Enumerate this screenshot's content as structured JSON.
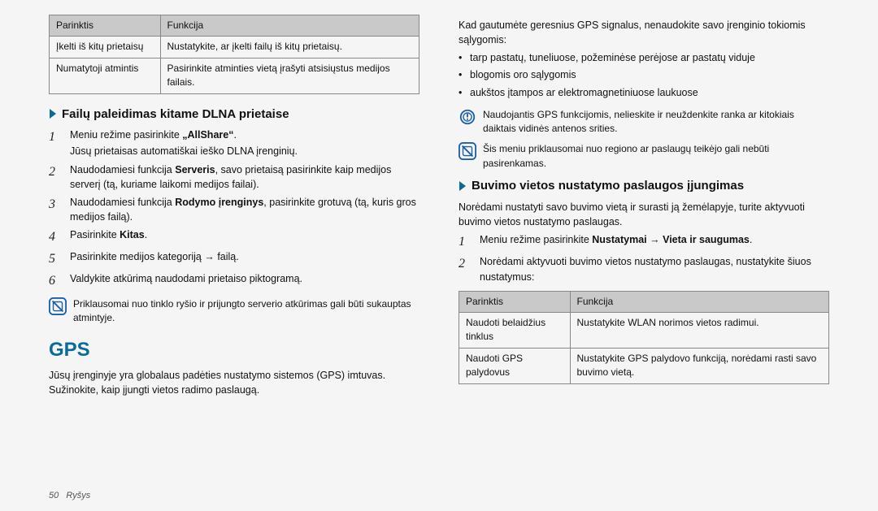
{
  "table1": {
    "header": {
      "option": "Parinktis",
      "func": "Funkcija"
    },
    "rows": [
      {
        "option": "Įkelti iš kitų prietaisų",
        "func": "Nustatykite, ar įkelti failų iš kitų prietaisų."
      },
      {
        "option": "Numatytoji atmintis",
        "func": "Pasirinkite atminties vietą įrašyti atsisiųstus medijos failais."
      }
    ]
  },
  "dlna": {
    "title": "Failų paleidimas kitame DLNA prietaise",
    "steps": [
      {
        "main_pre": "Meniu režime pasirinkite ",
        "main_bold": "„AllShare“",
        "main_post": ".",
        "sub": "Jūsų prietaisas automatiškai ieško DLNA įrenginių."
      },
      {
        "main_pre": "Naudodamiesi funkcija ",
        "main_bold": "Serveris",
        "main_post": ", savo prietaisą pasirinkite kaip medijos serverį (tą, kuriame laikomi medijos failai)."
      },
      {
        "main_pre": "Naudodamiesi funkcija ",
        "main_bold": "Rodymo įrenginys",
        "main_post": ", pasirinkite grotuvą (tą, kuris gros medijos failą)."
      },
      {
        "main_pre": "Pasirinkite ",
        "main_bold": "Kitas",
        "main_post": "."
      },
      {
        "main_pre": "Pasirinkite medijos kategoriją → failą."
      },
      {
        "main_pre": "Valdykite atkūrimą naudodami prietaiso piktogramą."
      }
    ],
    "note": "Priklausomai nuo tinklo ryšio ir prijungto serverio atkūrimas gali būti sukauptas atmintyje."
  },
  "gps": {
    "title": "GPS",
    "desc": "Jūsų įrenginyje yra globalaus padėties nustatymo sistemos (GPS) imtuvas. Sužinokite, kaip įjungti vietos radimo paslaugą."
  },
  "right": {
    "intro": "Kad gautumėte geresnius GPS signalus, nenaudokite savo įrenginio tokiomis sąlygomis:",
    "bullets": [
      "tarp pastatų, tuneliuose, požeminėse perėjose ar pastatų viduje",
      "blogomis oro sąlygomis",
      "aukštos įtampos ar elektromagnetiniuose laukuose"
    ],
    "note_warn": "Naudojantis GPS funkcijomis, nelieskite ir neuždenkite ranka ar kitokiais daiktais vidinės antenos srities.",
    "note_info": "Šis meniu priklausomai nuo regiono ar paslaugų teikėjo gali nebūti pasirenkamas."
  },
  "locate": {
    "title": "Buvimo vietos nustatymo paslaugos įjungimas",
    "desc": "Norėdami nustatyti savo buvimo vietą ir surasti ją žemėlapyje, turite aktyvuoti buvimo vietos nustatymo paslaugas.",
    "step1_pre": "Meniu režime pasirinkite ",
    "step1_bold1": "Nustatymai",
    "step1_arrow": " → ",
    "step1_bold2": "Vieta ir saugumas",
    "step1_post": ".",
    "step2": "Norėdami aktyvuoti buvimo vietos nustatymo paslaugas, nustatykite šiuos nustatymus:"
  },
  "table2": {
    "header": {
      "option": "Parinktis",
      "func": "Funkcija"
    },
    "rows": [
      {
        "option": "Naudoti belaidžius tinklus",
        "func": "Nustatykite WLAN norimos vietos radimui."
      },
      {
        "option": "Naudoti GPS palydovus",
        "func": "Nustatykite GPS palydovo funkciją, norėdami rasti savo buvimo vietą."
      }
    ]
  },
  "footer": {
    "page": "50",
    "section": "Ryšys"
  }
}
